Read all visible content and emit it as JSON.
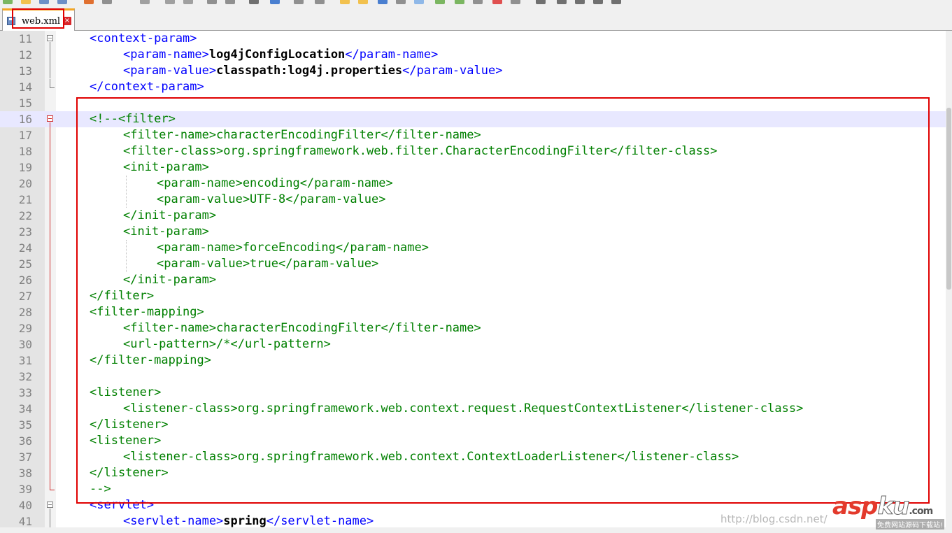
{
  "tab": {
    "label": "web.xml",
    "close_glyph": "×"
  },
  "lines": [
    {
      "n": "11",
      "indent": 1,
      "parts": [
        [
          "t",
          "<context-param>"
        ]
      ],
      "fold": "open"
    },
    {
      "n": "12",
      "indent": 2,
      "parts": [
        [
          "t",
          "<param-name>"
        ],
        [
          "v",
          "log4jConfigLocation"
        ],
        [
          "t",
          "</param-name>"
        ]
      ]
    },
    {
      "n": "13",
      "indent": 2,
      "parts": [
        [
          "t",
          "<param-value>"
        ],
        [
          "v",
          "classpath:log4j.properties"
        ],
        [
          "t",
          "</param-value>"
        ]
      ]
    },
    {
      "n": "14",
      "indent": 1,
      "parts": [
        [
          "t",
          "</context-param>"
        ]
      ],
      "fold": "end"
    },
    {
      "n": "15",
      "indent": 0,
      "parts": []
    },
    {
      "n": "16",
      "indent": 1,
      "parts": [
        [
          "cm",
          "<!--<filter>"
        ]
      ],
      "fold": "open-red",
      "current": true
    },
    {
      "n": "17",
      "indent": 2,
      "parts": [
        [
          "cm",
          "<filter-name>characterEncodingFilter</filter-name>"
        ]
      ]
    },
    {
      "n": "18",
      "indent": 2,
      "parts": [
        [
          "cm",
          "<filter-class>org.springframework.web.filter.CharacterEncodingFilter</filter-class>"
        ]
      ]
    },
    {
      "n": "19",
      "indent": 2,
      "parts": [
        [
          "cm",
          "<init-param>"
        ]
      ]
    },
    {
      "n": "20",
      "indent": 3,
      "parts": [
        [
          "cm",
          "<param-name>encoding</param-name>"
        ]
      ]
    },
    {
      "n": "21",
      "indent": 3,
      "parts": [
        [
          "cm",
          "<param-value>UTF-8</param-value>"
        ]
      ]
    },
    {
      "n": "22",
      "indent": 2,
      "parts": [
        [
          "cm",
          "</init-param>"
        ]
      ]
    },
    {
      "n": "23",
      "indent": 2,
      "parts": [
        [
          "cm",
          "<init-param>"
        ]
      ]
    },
    {
      "n": "24",
      "indent": 3,
      "parts": [
        [
          "cm",
          "<param-name>forceEncoding</param-name>"
        ]
      ]
    },
    {
      "n": "25",
      "indent": 3,
      "parts": [
        [
          "cm",
          "<param-value>true</param-value>"
        ]
      ]
    },
    {
      "n": "26",
      "indent": 2,
      "parts": [
        [
          "cm",
          "</init-param>"
        ]
      ]
    },
    {
      "n": "27",
      "indent": 1,
      "parts": [
        [
          "cm",
          "</filter>"
        ]
      ]
    },
    {
      "n": "28",
      "indent": 1,
      "parts": [
        [
          "cm",
          "<filter-mapping>"
        ]
      ]
    },
    {
      "n": "29",
      "indent": 2,
      "parts": [
        [
          "cm",
          "<filter-name>characterEncodingFilter</filter-name>"
        ]
      ]
    },
    {
      "n": "30",
      "indent": 2,
      "parts": [
        [
          "cm",
          "<url-pattern>/*</url-pattern>"
        ]
      ]
    },
    {
      "n": "31",
      "indent": 1,
      "parts": [
        [
          "cm",
          "</filter-mapping>"
        ]
      ]
    },
    {
      "n": "32",
      "indent": 0,
      "parts": []
    },
    {
      "n": "33",
      "indent": 1,
      "parts": [
        [
          "cm",
          "<listener>"
        ]
      ]
    },
    {
      "n": "34",
      "indent": 2,
      "parts": [
        [
          "cm",
          "<listener-class>org.springframework.web.context.request.RequestContextListener</listener-class>"
        ]
      ]
    },
    {
      "n": "35",
      "indent": 1,
      "parts": [
        [
          "cm",
          "</listener>"
        ]
      ]
    },
    {
      "n": "36",
      "indent": 1,
      "parts": [
        [
          "cm",
          "<listener>"
        ]
      ]
    },
    {
      "n": "37",
      "indent": 2,
      "parts": [
        [
          "cm",
          "<listener-class>org.springframework.web.context.ContextLoaderListener</listener-class>"
        ]
      ]
    },
    {
      "n": "38",
      "indent": 1,
      "parts": [
        [
          "cm",
          "</listener>"
        ]
      ]
    },
    {
      "n": "39",
      "indent": 1,
      "parts": [
        [
          "cm",
          "-->"
        ]
      ],
      "fold": "end-red"
    },
    {
      "n": "40",
      "indent": 1,
      "parts": [
        [
          "t",
          "<servlet>"
        ]
      ],
      "fold": "open"
    },
    {
      "n": "41",
      "indent": 2,
      "parts": [
        [
          "t",
          "<servlet-name>"
        ],
        [
          "v",
          "spring"
        ],
        [
          "t",
          "</servlet-name>"
        ]
      ]
    }
  ],
  "watermark": {
    "url": "http://blog.csdn.net/",
    "logo_asp": "asp",
    "logo_ku": "ku",
    "logo_com": ".com",
    "logo_cn": "免费网站源码下载站!"
  }
}
